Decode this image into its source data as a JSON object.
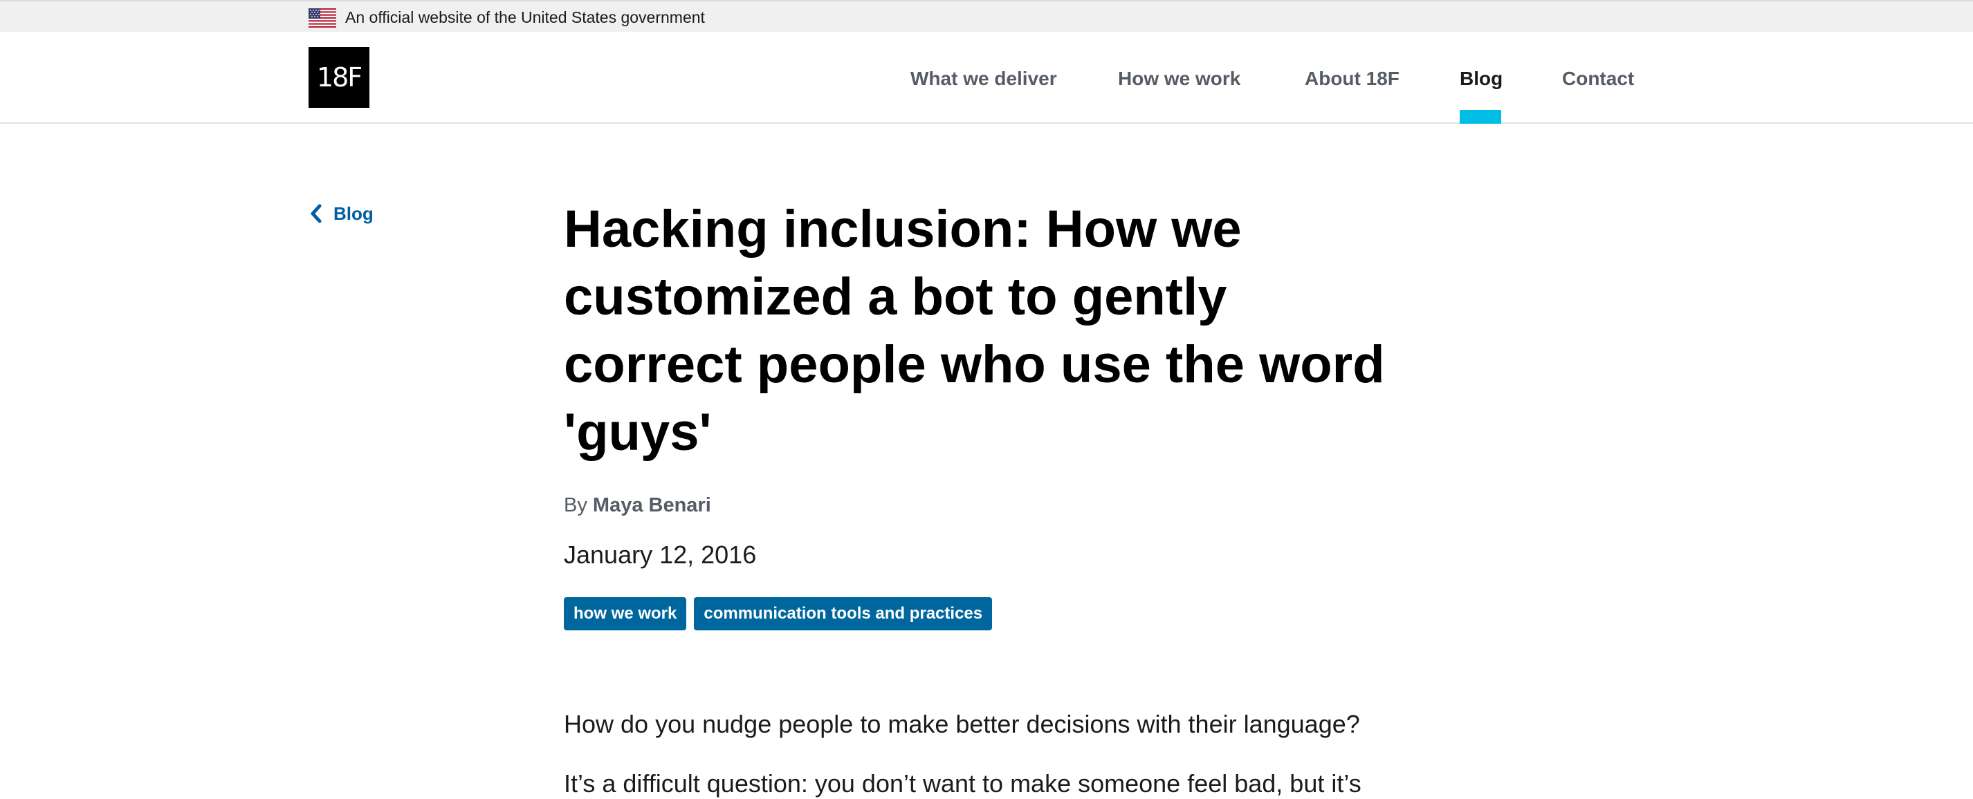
{
  "gov_banner": {
    "flag_icon": "us-flag-icon",
    "text": "An official website of the United States government"
  },
  "header": {
    "logo_text": "18F",
    "nav": [
      {
        "label": "What we deliver",
        "active": false
      },
      {
        "label": "How we work",
        "active": false
      },
      {
        "label": "About 18F",
        "active": false
      },
      {
        "label": "Blog",
        "active": true
      },
      {
        "label": "Contact",
        "active": false
      }
    ]
  },
  "back_link": {
    "icon": "chevron-left-icon",
    "label": "Blog"
  },
  "article": {
    "title_lines": [
      "Hacking inclusion: How we",
      "customized a bot to gently",
      "correct people who use the word",
      "'guys'"
    ],
    "byline_prefix": "By",
    "author": "Maya Benari",
    "date": "January 12, 2016",
    "tags": [
      "how we work",
      "communication tools and practices"
    ],
    "paragraphs": [
      "How do you nudge people to make better decisions with their language?",
      "It’s a difficult question: you don’t want to make someone feel bad, but it’s"
    ]
  },
  "colors": {
    "link_blue": "#005ea2",
    "tag_blue": "#00679e",
    "active_indicator": "#00bde3",
    "nav_gray": "#565c65",
    "banner_bg": "#f0f0f0"
  }
}
